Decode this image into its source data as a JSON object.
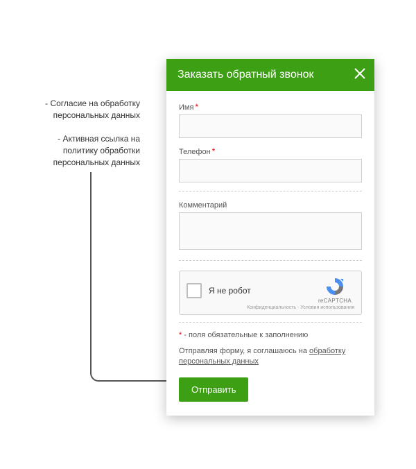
{
  "annotations": {
    "caption1": "- Согласие на обработку персональных данных",
    "caption2": "- Активная ссылка на политику обработки персональных данных"
  },
  "modal": {
    "title": "Заказать обратный звонок",
    "fields": {
      "name": {
        "label": "Имя",
        "required": true,
        "value": ""
      },
      "phone": {
        "label": "Телефон",
        "required": true,
        "value": ""
      },
      "comment": {
        "label": "Комментарий",
        "required": false,
        "value": ""
      }
    },
    "recaptcha": {
      "checkbox_label": "Я не робот",
      "brand": "reCAPTCHA",
      "policy_text": "Конфиденциальность - Условия использования"
    },
    "required_note_prefix": "*",
    "required_note": " - поля обязательные к заполнению",
    "consent_text": "Отправляя форму, я соглашаюсь на ",
    "consent_link": "обработку персональных данных",
    "submit_label": "Отправить"
  },
  "colors": {
    "accent": "#3da014",
    "danger": "#d00000"
  }
}
